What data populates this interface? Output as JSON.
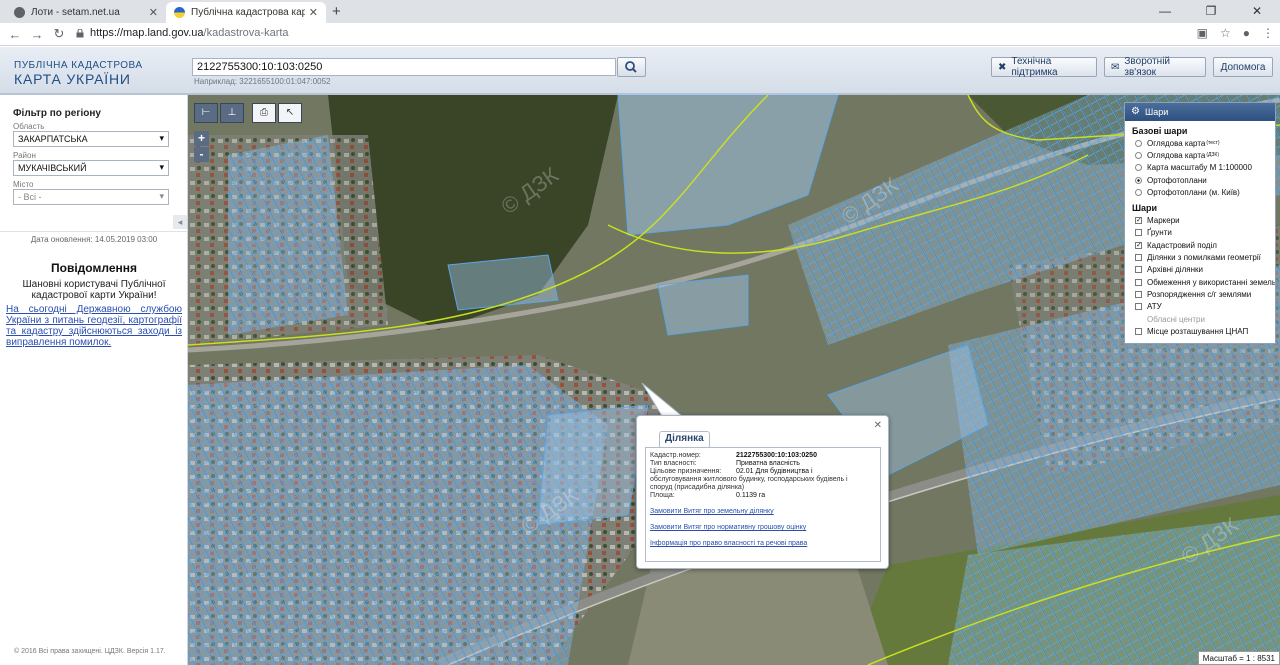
{
  "browser": {
    "tabs": [
      {
        "title": "Лоти - setam.net.ua",
        "active": false
      },
      {
        "title": "Публічна кадастрова карта Укр",
        "active": true
      }
    ],
    "url_host": "https://map.land.gov.ua",
    "url_path": "/kadastrova-karta"
  },
  "header": {
    "logo_line1": "ПУБЛІЧНА КАДАСТРОВА",
    "logo_line2": "КАРТА УКРАЇНИ",
    "search_value": "2122755300:10:103:0250",
    "search_hint": "Наприклад: 3221655100:01:047:0052",
    "buttons": [
      "Технічна підтримка",
      "Зворотній зв'язок",
      "Допомога"
    ]
  },
  "sidebar": {
    "title": "Фільтр по регіону",
    "region_label": "Область",
    "region_value": "ЗАКАРПАТСЬКА",
    "district_label": "Район",
    "district_value": "МУКАЧІВСЬКИЙ",
    "city_label": "Місто",
    "city_value": "- Всі -",
    "update_text": "Дата оновлення: 14.05.2019 03:00",
    "notice_title": "Повідомлення",
    "notice_body": "Шановні користувачі Публічної кадастрової карти України!",
    "notice_link": "На сьогодні Державною службою України з питань геодезії, картографії та кадастру здійснюються заходи із виправлення помилок.",
    "copyright": "© 2016 Всі права захищені. ЦДЗК. Версія 1.17."
  },
  "map": {
    "toolbar": [
      "measure-distance",
      "measure-area",
      "print",
      "identify"
    ],
    "zoom_in": "+",
    "zoom_out": "-",
    "scale_text": "Масштаб = 1 : 8531"
  },
  "layers": {
    "title": "Шари",
    "base_title": "Базові шари",
    "base": [
      {
        "label": "Оглядова карта",
        "sup": "(тест)",
        "checked": false
      },
      {
        "label": "Оглядова карта",
        "sup": "(ДЗК)",
        "checked": false
      },
      {
        "label": "Карта масштабу М 1:100000",
        "sup": "",
        "checked": false
      },
      {
        "label": "Ортофотоплани",
        "sup": "",
        "checked": true
      },
      {
        "label": "Ортофотоплани (м. Київ)",
        "sup": "",
        "checked": false
      }
    ],
    "overlay_title": "Шари",
    "overlays": [
      {
        "label": "Маркери",
        "checked": true,
        "disabled": false
      },
      {
        "label": "Ґрунти",
        "checked": false,
        "disabled": false
      },
      {
        "label": "Кадастровий поділ",
        "checked": true,
        "disabled": false
      },
      {
        "label": "Ділянки з помилками геометрії",
        "checked": false,
        "disabled": false
      },
      {
        "label": "Архівні ділянки",
        "checked": false,
        "disabled": false
      },
      {
        "label": "Обмеження у використанні земель",
        "checked": false,
        "disabled": false
      },
      {
        "label": "Розпорядження с/г землями",
        "checked": false,
        "disabled": false
      },
      {
        "label": "АТУ",
        "checked": false,
        "disabled": false
      },
      {
        "label": "Обласні центри",
        "checked": false,
        "disabled": true
      },
      {
        "label": "Місце розташування ЦНАП",
        "checked": false,
        "disabled": false
      }
    ]
  },
  "popup": {
    "tab": "Ділянка",
    "rows": [
      {
        "label": "Кадастр.номер:",
        "value": "2122755300:10:103:0250",
        "bold": true
      },
      {
        "label": "Тип власності:",
        "value": "Приватна власність",
        "bold": false
      },
      {
        "label": "Цільове призначення:",
        "value": "02.01 Для будівництва і",
        "bold": false
      }
    ],
    "purpose_cont1": "обслуговування житлового будинку, господарських будівель і",
    "purpose_cont2": "споруд (присадибна ділянка)",
    "area_label": "Площа:",
    "area_value": "0.1139 га",
    "links": [
      "Замовити Витяг про земельну ділянку",
      "Замовити Витяг про нормативну грошову оцінку",
      "Інформація про право власності та речові права"
    ]
  },
  "colors": {
    "parcel_fill": "#9ec3e6",
    "parcel_stroke": "#5aa6e6",
    "boundary": "#c8e020",
    "header_text": "#1f4f86",
    "link": "#2a4fb0"
  }
}
